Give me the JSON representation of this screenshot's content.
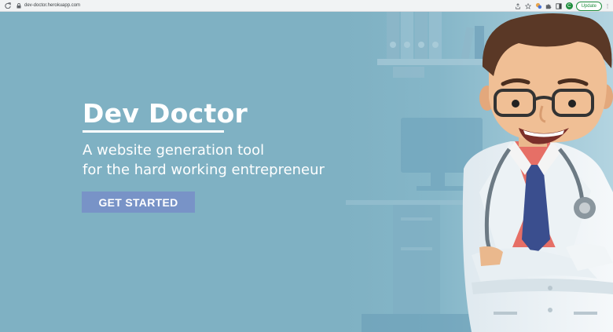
{
  "browser": {
    "url": "dev-doctor.herokuapp.com",
    "avatar_letter": "C",
    "update_label": "Update",
    "icons": [
      "reload-icon",
      "lock-icon",
      "share-icon",
      "star-icon",
      "extension-icon",
      "puzzle-icon",
      "sidepanel-icon",
      "more-icon"
    ]
  },
  "hero": {
    "title": "Dev Doctor",
    "tagline_line1": "A website generation tool",
    "tagline_line2": "for the hard working entrepreneur",
    "cta_label": "GET STARTED"
  },
  "colors": {
    "hero_bg": "#7fb1c3",
    "cta_bg": "#7893c7",
    "update_green": "#1e8e3e"
  }
}
